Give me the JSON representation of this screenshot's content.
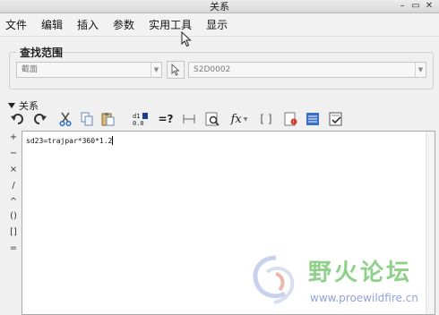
{
  "window": {
    "title": "关系"
  },
  "menubar": {
    "items": [
      "文件",
      "编辑",
      "插入",
      "参数",
      "实用工具",
      "显示"
    ]
  },
  "search_scope": {
    "label": "查找范围",
    "scope_value": "截面",
    "object_value": "S2D0002"
  },
  "relations": {
    "header": "关系",
    "toolbar_icons": [
      "undo-icon",
      "redo-icon",
      "cut-icon",
      "copy-icon",
      "paste-icon",
      "switch-dims-icon",
      "evaluate-icon",
      "dimension-icon",
      "verify-icon",
      "function-icon",
      "params-icon",
      "sort-icon",
      "insert-icon",
      "verify-list-icon"
    ],
    "operators": [
      "+",
      "−",
      "×",
      "/",
      "^",
      "()",
      "[]",
      "="
    ],
    "editor_text": "sd23=trajpar*360*1.2"
  },
  "watermark": {
    "text": "野火论坛",
    "url": "www.proewildfire.cn"
  },
  "colors": {
    "watermark_green": "#8fd18a",
    "watermark_blue": "#8fa4d8"
  }
}
